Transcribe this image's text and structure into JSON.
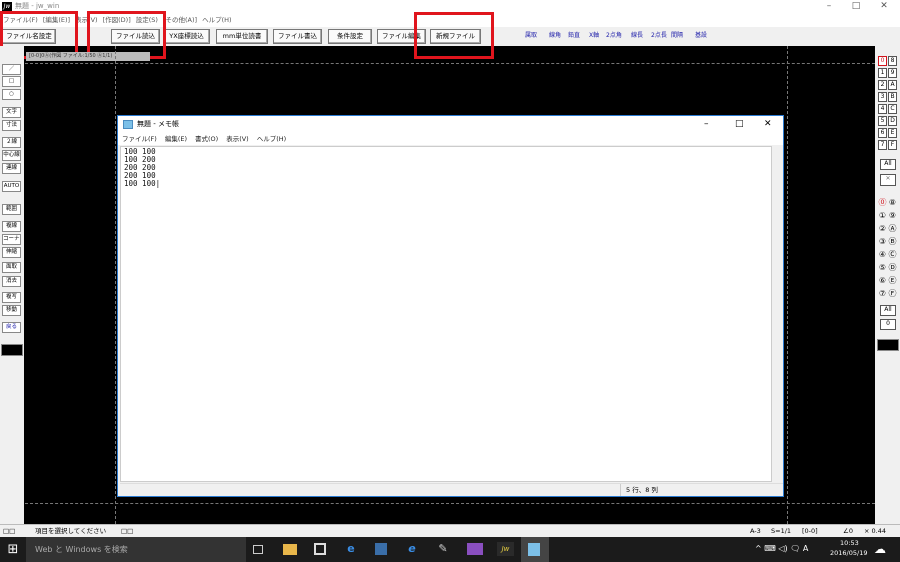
{
  "window": {
    "title": "無題 - jw_win",
    "icon_label": "Jw",
    "minimize": "–",
    "maximize": "□",
    "close": "✕"
  },
  "menu": [
    "ファイル(F)",
    "[編集(E)]",
    "表示(V)",
    "[作図(D)]",
    "設定(S)",
    "[その他(A)]",
    "ヘルプ(H)"
  ],
  "toolbar": {
    "buttons": [
      "ファイル名設定",
      "ファイル読込",
      "YX座標読込",
      "mm単位読書",
      "ファイル書込",
      "条件設定",
      "ファイル編集",
      "新規ファイル"
    ],
    "snap_buttons": [
      "属取",
      "線角",
      "鉛直",
      "X軸",
      "2点角",
      "線長",
      "2点長",
      "間隔",
      "基設"
    ]
  },
  "left_tools": [
    "／",
    "□",
    "○",
    "文字",
    "寸法",
    "２線",
    "中心線",
    "連線",
    "AUTO",
    "範囲",
    "複線",
    "コーナー",
    "伸縮",
    "面取",
    "消去",
    "複写",
    "移動",
    "戻る"
  ],
  "right_tools": {
    "layer_group_pairs": [
      [
        "0",
        "8"
      ],
      [
        "1",
        "9"
      ],
      [
        "2",
        "A"
      ],
      [
        "3",
        "B"
      ],
      [
        "4",
        "C"
      ],
      [
        "5",
        "D"
      ],
      [
        "6",
        "E"
      ],
      [
        "7",
        "F"
      ]
    ],
    "layer_pairs": [
      [
        "⓪",
        "⑧"
      ],
      [
        "①",
        "⑨"
      ],
      [
        "②",
        "Ⓐ"
      ],
      [
        "③",
        "Ⓑ"
      ],
      [
        "④",
        "Ⓒ"
      ],
      [
        "⑤",
        "Ⓓ"
      ],
      [
        "⑥",
        "Ⓔ"
      ],
      [
        "⑦",
        "Ⓕ"
      ]
    ],
    "all_label": "All",
    "cross_label": "✕",
    "zero_label": "0"
  },
  "canvas_tab": "[0-0]0Ⓐ(作図 ファイル:1/50 Ⓐ1/1)",
  "notepad": {
    "title": "無題 - メモ帳",
    "menu": [
      "ファイル(F)",
      "編集(E)",
      "書式(O)",
      "表示(V)",
      "ヘルプ(H)"
    ],
    "lines": [
      "100  100",
      "100  200",
      "200  200",
      "200  100",
      "100  100|"
    ],
    "status": "5 行、8 列",
    "minimize": "–",
    "maximize": "□",
    "close": "✕"
  },
  "statusbar": {
    "left_glyph": "□□",
    "message": "項目を選択してください",
    "msg_glyph": "□□",
    "paper": "A-3",
    "scale": "S=1/1",
    "layer": "[0-0]",
    "angle": "∠0",
    "zoom": "× 0.44"
  },
  "taskbar": {
    "start": "⊞",
    "search_placeholder": "Web と Windows を検索",
    "icons": [
      "task-view-icon",
      "file-explorer-icon",
      "store-icon",
      "edge-icon",
      "media-player-icon",
      "internet-explorer-icon",
      "paint-icon",
      "photo-app-icon",
      "jw-cad-icon",
      "notepad-icon"
    ],
    "tray": "^ ⌨ ◁) 🗨 A",
    "time": "10:53",
    "date": "2016/05/19"
  }
}
